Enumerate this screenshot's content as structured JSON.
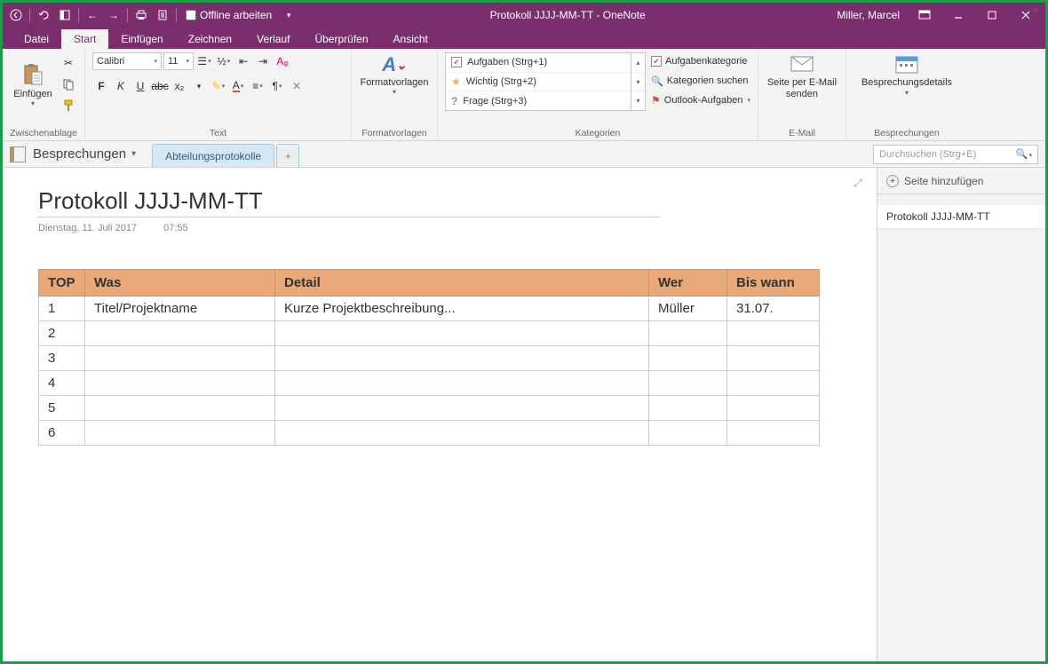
{
  "titlebar": {
    "offline_label": "Offline arbeiten",
    "title": "Protokoll JJJJ-MM-TT  -  OneNote",
    "user": "Miller, Marcel"
  },
  "tabs": {
    "datei": "Datei",
    "start": "Start",
    "einfuegen": "Einfügen",
    "zeichnen": "Zeichnen",
    "verlauf": "Verlauf",
    "ueberpruefen": "Überprüfen",
    "ansicht": "Ansicht"
  },
  "ribbon": {
    "clipboard": {
      "paste": "Einfügen",
      "group": "Zwischenablage"
    },
    "font": {
      "name": "Calibri",
      "size": "11",
      "group": "Text"
    },
    "styles": {
      "btn": "Formatvorlagen",
      "group": "Formatvorlagen"
    },
    "tags": {
      "item1": "Aufgaben (Strg+1)",
      "item2": "Wichtig (Strg+2)",
      "item3": "Frage (Strg+3)",
      "side1": "Aufgabenkategorie",
      "side2": "Kategorien suchen",
      "side3": "Outlook-Aufgaben",
      "group": "Kategorien"
    },
    "email": {
      "btn": "Seite per E-Mail senden",
      "group": "E-Mail"
    },
    "meeting": {
      "btn": "Besprechungsdetails",
      "group": "Besprechungen"
    }
  },
  "notebook": {
    "name": "Besprechungen",
    "section1": "Abteilungsprotokolle",
    "search_placeholder": "Durchsuchen (Strg+E)"
  },
  "page": {
    "title": "Protokoll JJJJ-MM-TT",
    "date": "Dienstag, 11. Juli 2017",
    "time": "07:55"
  },
  "table": {
    "h_top": "TOP",
    "h_was": "Was",
    "h_detail": "Detail",
    "h_wer": "Wer",
    "h_bis": "Bis wann",
    "rows": [
      {
        "top": "1",
        "was": "Titel/Projektname",
        "detail": "Kurze Projektbeschreibung...",
        "wer": "Müller",
        "bis": "31.07."
      },
      {
        "top": "2",
        "was": "",
        "detail": "",
        "wer": "",
        "bis": ""
      },
      {
        "top": "3",
        "was": "",
        "detail": "",
        "wer": "",
        "bis": ""
      },
      {
        "top": "4",
        "was": "",
        "detail": "",
        "wer": "",
        "bis": ""
      },
      {
        "top": "5",
        "was": "",
        "detail": "",
        "wer": "",
        "bis": ""
      },
      {
        "top": "6",
        "was": "",
        "detail": "",
        "wer": "",
        "bis": ""
      }
    ]
  },
  "sidepanel": {
    "add_page": "Seite hinzufügen",
    "page1": "Protokoll JJJJ-MM-TT"
  }
}
